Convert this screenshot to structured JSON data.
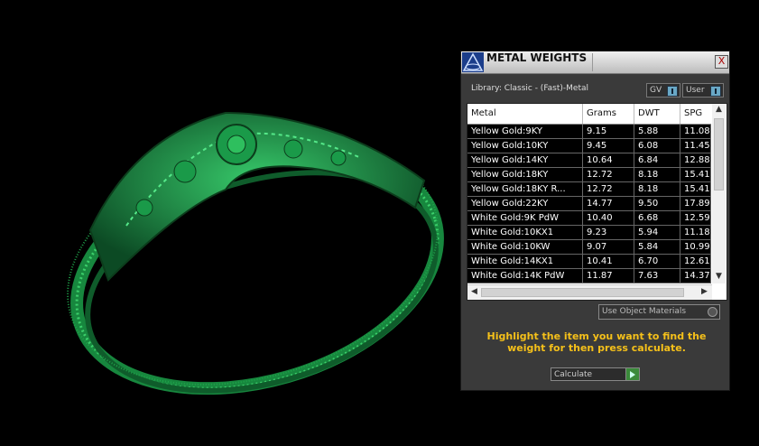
{
  "viewport": {
    "object": "green 3D bangle model"
  },
  "panel": {
    "title": "METAL WEIGHTS",
    "close_label": "X",
    "library_label": "Library: Classic - (Fast)-Metal",
    "gv_label": "GV",
    "user_label": "User",
    "columns": [
      "Metal",
      "Grams",
      "DWT",
      "SPG"
    ],
    "rows": [
      [
        "Yellow Gold:9KY",
        "9.15",
        "5.88",
        "11.08"
      ],
      [
        "Yellow Gold:10KY",
        "9.45",
        "6.08",
        "11.45"
      ],
      [
        "Yellow Gold:14KY",
        "10.64",
        "6.84",
        "12.88"
      ],
      [
        "Yellow Gold:18KY",
        "12.72",
        "8.18",
        "15.41"
      ],
      [
        "Yellow Gold:18KY R...",
        "12.72",
        "8.18",
        "15.41"
      ],
      [
        "Yellow Gold:22KY",
        "14.77",
        "9.50",
        "17.89"
      ],
      [
        "White Gold:9K PdW",
        "10.40",
        "6.68",
        "12.59"
      ],
      [
        "White Gold:10KX1",
        "9.23",
        "5.94",
        "11.18"
      ],
      [
        "White Gold:10KW",
        "9.07",
        "5.84",
        "10.99"
      ],
      [
        "White Gold:14KX1",
        "10.41",
        "6.70",
        "12.61"
      ],
      [
        "White Gold:14K PdW",
        "11.87",
        "7.63",
        "14.37"
      ]
    ],
    "use_object_materials": "Use Object Materials",
    "instruction": "Highlight the item you want to find the weight for then press calculate.",
    "calculate_label": "Calculate"
  }
}
